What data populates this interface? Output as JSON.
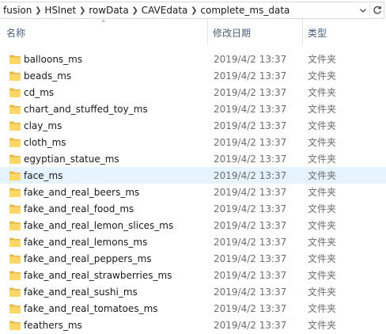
{
  "address_bar": {
    "crumbs": [
      "fusion",
      "HSInet",
      "rowData",
      "CAVEdata",
      "complete_ms_data"
    ],
    "dropdown_icon": "chevron-down-icon",
    "refresh_icon": "refresh-icon"
  },
  "columns": {
    "name": "名称",
    "date": "修改日期",
    "type": "类型",
    "sort_icon": "sort-up-icon"
  },
  "files": [
    {
      "name": "balloons_ms",
      "date": "2019/4/2 13:37",
      "type": "文件夹"
    },
    {
      "name": "beads_ms",
      "date": "2019/4/2 13:37",
      "type": "文件夹"
    },
    {
      "name": "cd_ms",
      "date": "2019/4/2 13:37",
      "type": "文件夹"
    },
    {
      "name": "chart_and_stuffed_toy_ms",
      "date": "2019/4/2 13:37",
      "type": "文件夹"
    },
    {
      "name": "clay_ms",
      "date": "2019/4/2 13:37",
      "type": "文件夹"
    },
    {
      "name": "cloth_ms",
      "date": "2019/4/2 13:37",
      "type": "文件夹"
    },
    {
      "name": "egyptian_statue_ms",
      "date": "2019/4/2 13:37",
      "type": "文件夹"
    },
    {
      "name": "face_ms",
      "date": "2019/4/2 13:37",
      "type": "文件夹",
      "hovered": true
    },
    {
      "name": "fake_and_real_beers_ms",
      "date": "2019/4/2 13:37",
      "type": "文件夹"
    },
    {
      "name": "fake_and_real_food_ms",
      "date": "2019/4/2 13:37",
      "type": "文件夹"
    },
    {
      "name": "fake_and_real_lemon_slices_ms",
      "date": "2019/4/2 13:37",
      "type": "文件夹"
    },
    {
      "name": "fake_and_real_lemons_ms",
      "date": "2019/4/2 13:37",
      "type": "文件夹"
    },
    {
      "name": "fake_and_real_peppers_ms",
      "date": "2019/4/2 13:37",
      "type": "文件夹"
    },
    {
      "name": "fake_and_real_strawberries_ms",
      "date": "2019/4/2 13:37",
      "type": "文件夹"
    },
    {
      "name": "fake_and_real_sushi_ms",
      "date": "2019/4/2 13:37",
      "type": "文件夹"
    },
    {
      "name": "fake_and_real_tomatoes_ms",
      "date": "2019/4/2 13:37",
      "type": "文件夹"
    },
    {
      "name": "feathers_ms",
      "date": "2019/4/2 13:37",
      "type": "文件夹"
    }
  ],
  "colors": {
    "hover_row": "#e5f3ff",
    "folder": "#ffd766",
    "header_text": "#4c607a"
  }
}
